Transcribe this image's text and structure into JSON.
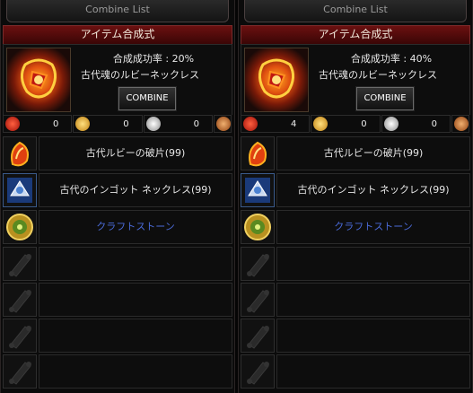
{
  "panels": [
    {
      "tab_title": "Combine List",
      "header": "アイテム合成式",
      "rate": "合成成功率 : 20%",
      "item_name": "古代魂のルビーネックレス",
      "combine_label": "COMBINE",
      "counters": [
        "0",
        "0",
        "0"
      ],
      "slots": [
        {
          "name": "古代ルビーの破片(99)",
          "icon": "ruby-fragment-icon"
        },
        {
          "name": "古代のインゴット ネックレス(99)",
          "icon": "ingot-necklace-icon"
        },
        {
          "name": "クラフトストーン",
          "icon": "craft-stone-icon"
        },
        {
          "name": "",
          "icon": "empty-scroll-icon"
        },
        {
          "name": "",
          "icon": "empty-scroll-icon"
        },
        {
          "name": "",
          "icon": "empty-scroll-icon"
        },
        {
          "name": "",
          "icon": "empty-scroll-icon"
        }
      ]
    },
    {
      "tab_title": "Combine List",
      "header": "アイテム合成式",
      "rate": "合成成功率 : 40%",
      "item_name": "古代魂のルビーネックレス",
      "combine_label": "COMBINE",
      "counters": [
        "4",
        "0",
        "0"
      ],
      "slots": [
        {
          "name": "古代ルビーの破片(99)",
          "icon": "ruby-fragment-icon"
        },
        {
          "name": "古代のインゴット ネックレス(99)",
          "icon": "ingot-necklace-icon"
        },
        {
          "name": "クラフトストーン",
          "icon": "craft-stone-icon"
        },
        {
          "name": "",
          "icon": "empty-scroll-icon"
        },
        {
          "name": "",
          "icon": "empty-scroll-icon"
        },
        {
          "name": "",
          "icon": "empty-scroll-icon"
        },
        {
          "name": "",
          "icon": "empty-scroll-icon"
        }
      ]
    }
  ],
  "colors": {
    "header_red": "#6b1010",
    "craft_stone_blue": "#4a6ad8"
  }
}
